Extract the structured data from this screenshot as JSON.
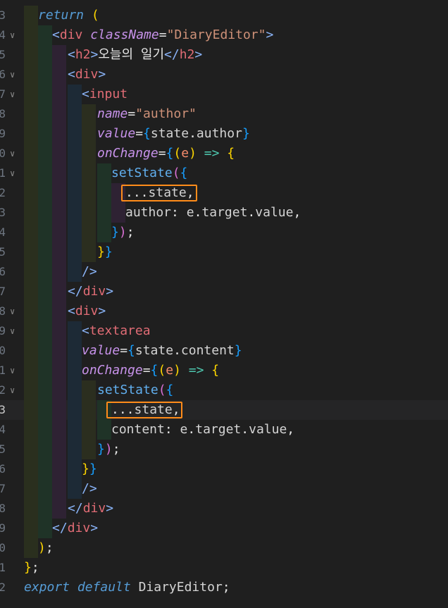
{
  "editor": {
    "lines": [
      {
        "num": "3",
        "fold": "",
        "text": "return ("
      },
      {
        "num": "4",
        "fold": "∨",
        "text": "<div className=\"DiaryEditor\">"
      },
      {
        "num": "5",
        "fold": "",
        "text": "<h2>오늘의 일기</h2>"
      },
      {
        "num": "6",
        "fold": "∨",
        "text": "<div>"
      },
      {
        "num": "7",
        "fold": "∨",
        "text": "<input"
      },
      {
        "num": "8",
        "fold": "",
        "text": "name=\"author\""
      },
      {
        "num": "9",
        "fold": "",
        "text": "value={state.author}"
      },
      {
        "num": "0",
        "fold": "∨",
        "text": "onChange={(e) => {"
      },
      {
        "num": "1",
        "fold": "∨",
        "text": "setState({"
      },
      {
        "num": "2",
        "fold": "",
        "text": "...state,"
      },
      {
        "num": "3",
        "fold": "",
        "text": "author: e.target.value,"
      },
      {
        "num": "4",
        "fold": "",
        "text": "});"
      },
      {
        "num": "5",
        "fold": "",
        "text": "}}"
      },
      {
        "num": "6",
        "fold": "",
        "text": "/>"
      },
      {
        "num": "7",
        "fold": "",
        "text": "</div>"
      },
      {
        "num": "8",
        "fold": "∨",
        "text": "<div>"
      },
      {
        "num": "9",
        "fold": "∨",
        "text": "<textarea"
      },
      {
        "num": "0",
        "fold": "",
        "text": "value={state.content}"
      },
      {
        "num": "1",
        "fold": "∨",
        "text": "onChange={(e) => {"
      },
      {
        "num": "2",
        "fold": "∨",
        "text": "setState({"
      },
      {
        "num": "3",
        "fold": "",
        "text": "...state,"
      },
      {
        "num": "4",
        "fold": "",
        "text": "content: e.target.value,"
      },
      {
        "num": "5",
        "fold": "",
        "text": "});"
      },
      {
        "num": "6",
        "fold": "",
        "text": "}}"
      },
      {
        "num": "7",
        "fold": "",
        "text": "/>"
      },
      {
        "num": "8",
        "fold": "",
        "text": "</div>"
      },
      {
        "num": "9",
        "fold": "",
        "text": "</div>"
      },
      {
        "num": "0",
        "fold": "",
        "text": ");"
      },
      {
        "num": "1",
        "fold": "",
        "text": "};"
      },
      {
        "num": "2",
        "fold": "",
        "text": "export default DiaryEditor;"
      }
    ],
    "active_line_num": "3",
    "colors": {
      "background": "#1f1f1f",
      "highlight_box": "#ff8c1a"
    }
  }
}
